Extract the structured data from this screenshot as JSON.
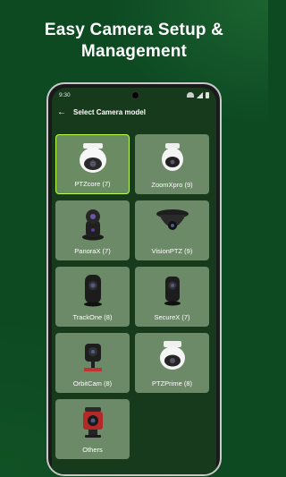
{
  "headline": {
    "line1": "Easy Camera Setup &",
    "line2": "Management"
  },
  "status": {
    "time": "9:30"
  },
  "appbar": {
    "back_icon": "arrow-left",
    "title": "Select Camera model"
  },
  "colors": {
    "selected_border": "#b8ff4a",
    "tile_bg": "#6c8a67",
    "screen_bg": "#17391c"
  },
  "cameras": [
    {
      "label": "PTZcore (7)",
      "icon": "dome-camera-white",
      "selected": true
    },
    {
      "label": "ZoomXpro (9)",
      "icon": "dome-camera-white-small"
    },
    {
      "label": "PanoraX (7)",
      "icon": "pan-tilt-camera-black"
    },
    {
      "label": "VisionPTZ (9)",
      "icon": "ceiling-dome-camera-black"
    },
    {
      "label": "TrackOne (8)",
      "icon": "cube-camera-black"
    },
    {
      "label": "SecureX (7)",
      "icon": "cube-camera-black-small"
    },
    {
      "label": "OrbitCam (8)",
      "icon": "bracket-camera-black"
    },
    {
      "label": "PTZPrime (8)",
      "icon": "dome-camera-white-ceiling"
    },
    {
      "label": "Others",
      "icon": "red-camera"
    }
  ]
}
